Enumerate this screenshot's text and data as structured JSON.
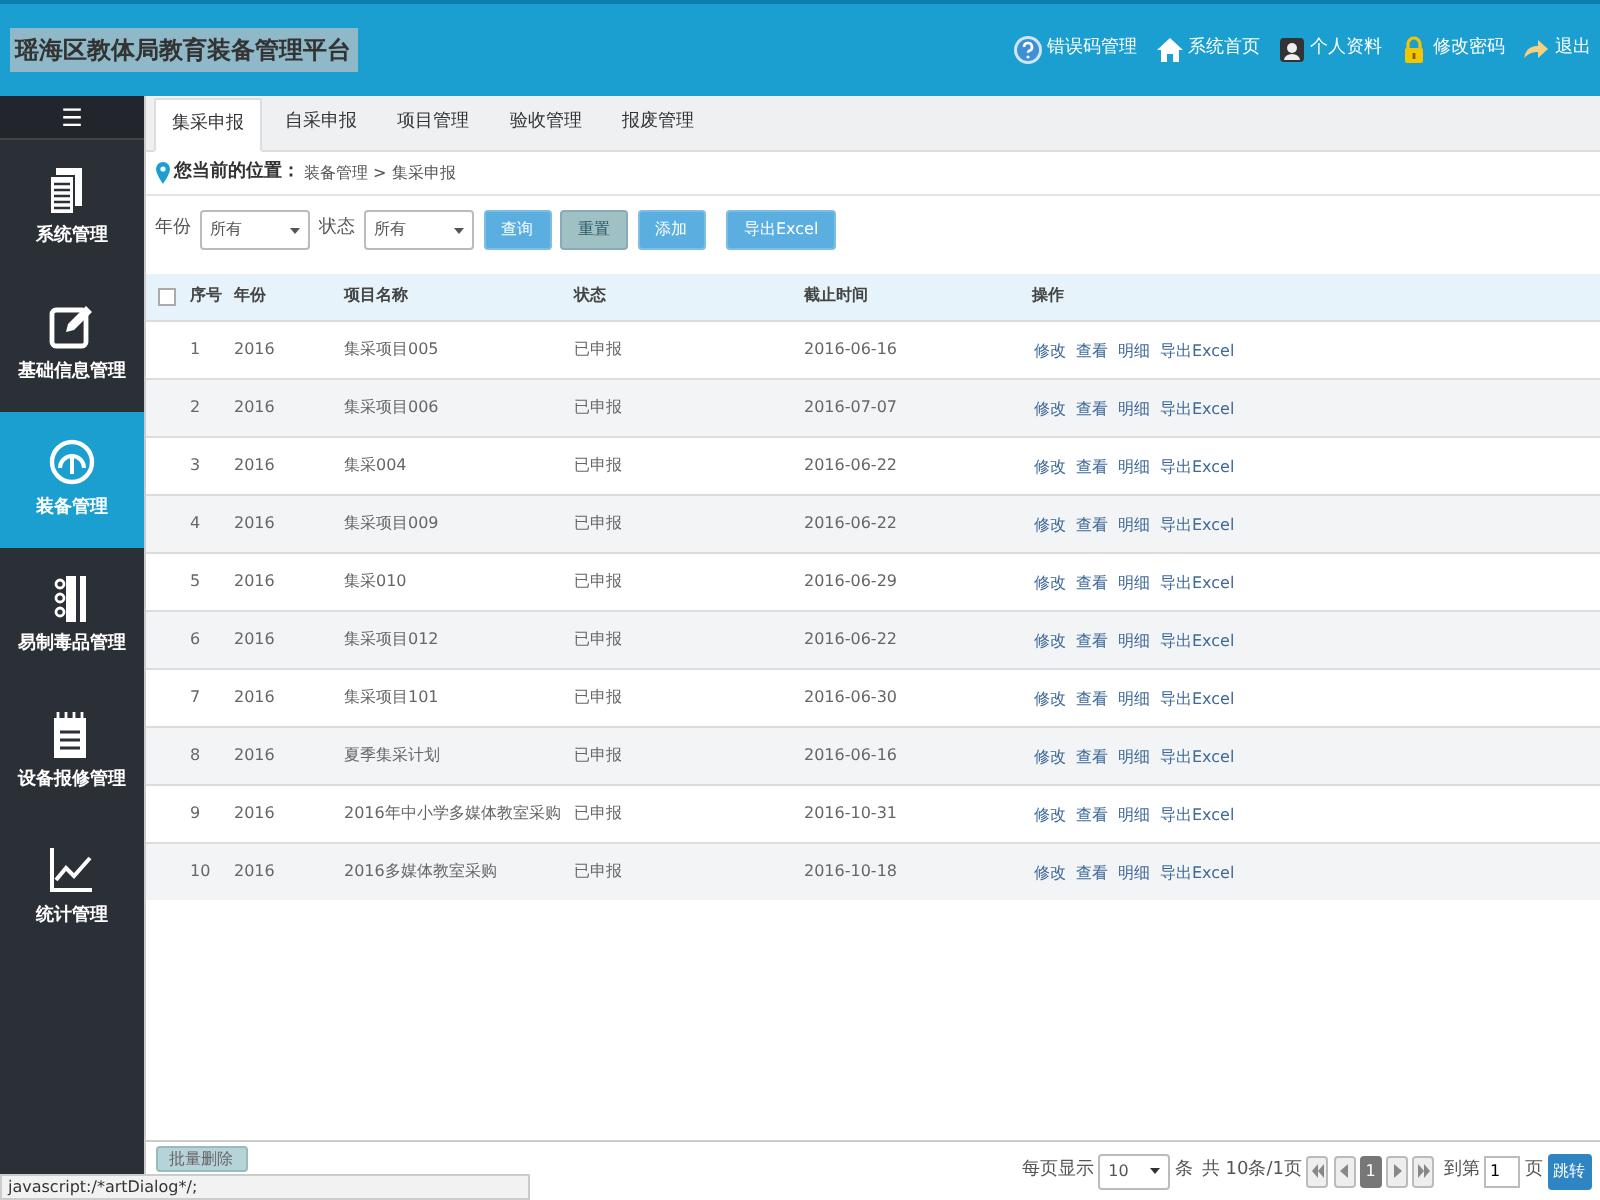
{
  "header": {
    "title": "瑶海区教体局教育装备管理平台",
    "links": [
      {
        "label": "错误码管理"
      },
      {
        "label": "系统首页"
      },
      {
        "label": "个人资料"
      },
      {
        "label": "修改密码"
      },
      {
        "label": "退出"
      }
    ]
  },
  "sidebar": {
    "toggle": "☰",
    "items": [
      {
        "label": "系统管理",
        "selected": false
      },
      {
        "label": "基础信息管理",
        "selected": false
      },
      {
        "label": "装备管理",
        "selected": true
      },
      {
        "label": "易制毒品管理",
        "selected": false
      },
      {
        "label": "设备报修管理",
        "selected": false
      },
      {
        "label": "统计管理",
        "selected": false
      }
    ]
  },
  "tabs": [
    {
      "label": "集采申报",
      "selected": true
    },
    {
      "label": "自采申报",
      "selected": false
    },
    {
      "label": "项目管理",
      "selected": false
    },
    {
      "label": "验收管理",
      "selected": false
    },
    {
      "label": "报废管理",
      "selected": false
    }
  ],
  "breadcrumb": {
    "label": "您当前的位置：",
    "path": "装备管理 > 集采申报"
  },
  "filters": [
    {
      "label": "年份",
      "value": "所有"
    },
    {
      "label": "状态",
      "value": "所有"
    }
  ],
  "buttons": [
    {
      "label": "查询",
      "kind": "primary"
    },
    {
      "label": "重置",
      "kind": "muted"
    },
    {
      "label": "添加",
      "kind": "primary"
    },
    {
      "label": "导出Excel",
      "kind": "primary"
    }
  ],
  "table": {
    "select_all_checked": false,
    "columns": [
      "序号",
      "年份",
      "项目名称",
      "状态",
      "截止时间",
      "操作"
    ],
    "rows": [
      {
        "cells": [
          "1",
          "2016",
          "集采项目005",
          "已申报",
          "2016-06-16"
        ],
        "actions": [
          "修改",
          "查看",
          "明细",
          "导出Excel"
        ]
      },
      {
        "cells": [
          "2",
          "2016",
          "集采项目006",
          "已申报",
          "2016-07-07"
        ],
        "actions": [
          "修改",
          "查看",
          "明细",
          "导出Excel"
        ]
      },
      {
        "cells": [
          "3",
          "2016",
          "集采004",
          "已申报",
          "2016-06-22"
        ],
        "actions": [
          "修改",
          "查看",
          "明细",
          "导出Excel"
        ]
      },
      {
        "cells": [
          "4",
          "2016",
          "集采项目009",
          "已申报",
          "2016-06-22"
        ],
        "actions": [
          "修改",
          "查看",
          "明细",
          "导出Excel"
        ]
      },
      {
        "cells": [
          "5",
          "2016",
          "集采010",
          "已申报",
          "2016-06-29"
        ],
        "actions": [
          "修改",
          "查看",
          "明细",
          "导出Excel"
        ]
      },
      {
        "cells": [
          "6",
          "2016",
          "集采项目012",
          "已申报",
          "2016-06-22"
        ],
        "actions": [
          "修改",
          "查看",
          "明细",
          "导出Excel"
        ]
      },
      {
        "cells": [
          "7",
          "2016",
          "集采项目101",
          "已申报",
          "2016-06-30"
        ],
        "actions": [
          "修改",
          "查看",
          "明细",
          "导出Excel"
        ]
      },
      {
        "cells": [
          "8",
          "2016",
          "夏季集采计划",
          "已申报",
          "2016-06-16"
        ],
        "actions": [
          "修改",
          "查看",
          "明细",
          "导出Excel"
        ]
      },
      {
        "cells": [
          "9",
          "2016",
          "2016年中小学多媒体教室采购",
          "已申报",
          "2016-10-31"
        ],
        "actions": [
          "修改",
          "查看",
          "明细",
          "导出Excel"
        ]
      },
      {
        "cells": [
          "10",
          "2016",
          "2016多媒体教室采购",
          "已申报",
          "2016-10-18"
        ],
        "actions": [
          "修改",
          "查看",
          "明细",
          "导出Excel"
        ]
      }
    ]
  },
  "footer": {
    "batch_button": "批量删除",
    "per_page_label": "每页显示",
    "per_page": "10",
    "per_page_unit": "条",
    "summary": "共 10条/1页",
    "current_page": "1",
    "goto_label": "到第",
    "goto_value": "1",
    "goto_unit": "页",
    "jump_button": "跳转"
  },
  "status_bar": "javascript:/*artDialog*/;"
}
